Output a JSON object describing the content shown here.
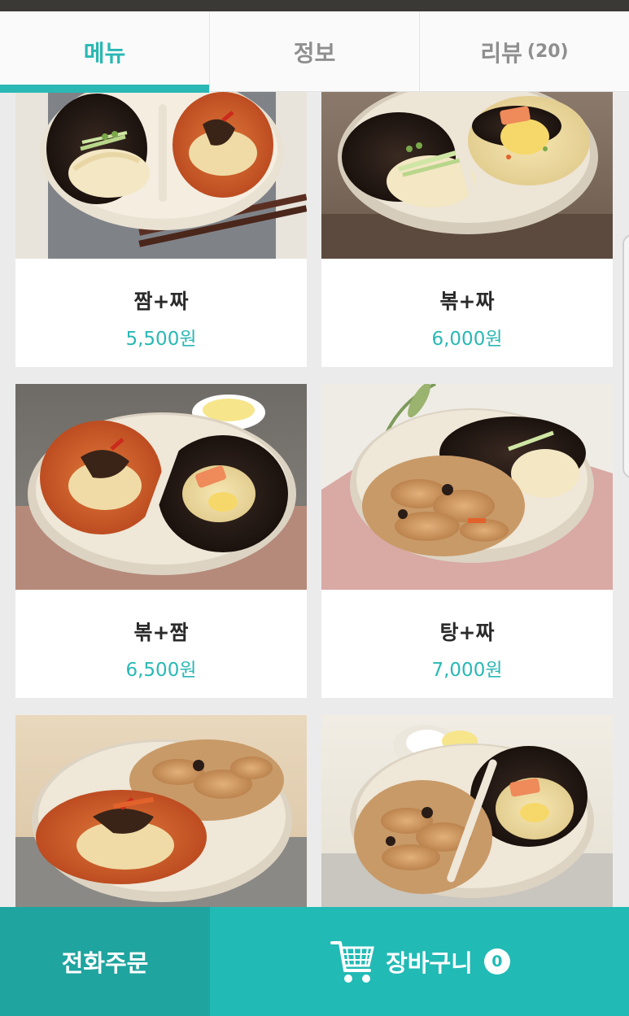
{
  "tabs": [
    {
      "label": "메뉴",
      "active": true
    },
    {
      "label": "정보",
      "active": false
    },
    {
      "label": "리뷰",
      "count": "(20)",
      "active": false
    }
  ],
  "menu_items": [
    {
      "name": "짬+짜",
      "price": "5,500원",
      "image": "jjamppong-jjajang-bowl"
    },
    {
      "name": "볶+짜",
      "price": "6,000원",
      "image": "friedrice-jjajang-bowl"
    },
    {
      "name": "볶+짬",
      "price": "6,500원",
      "image": "friedrice-jjamppong-bowl"
    },
    {
      "name": "탕+짜",
      "price": "7,000원",
      "image": "tangsuyuk-jjajang-bowl"
    },
    {
      "name": "",
      "price": "",
      "image": "tangsuyuk-jjamppong-bowl"
    },
    {
      "name": "",
      "price": "",
      "image": "tangsuyuk-friedrice-bowl"
    }
  ],
  "bottom_bar": {
    "call_label": "전화주문",
    "cart_label": "장바구니",
    "cart_count": "0",
    "cart_icon": "shopping-cart-icon"
  },
  "colors": {
    "accent": "#2ab8b4",
    "call_bg": "#1fa49f",
    "cart_bg": "#22bab5"
  }
}
